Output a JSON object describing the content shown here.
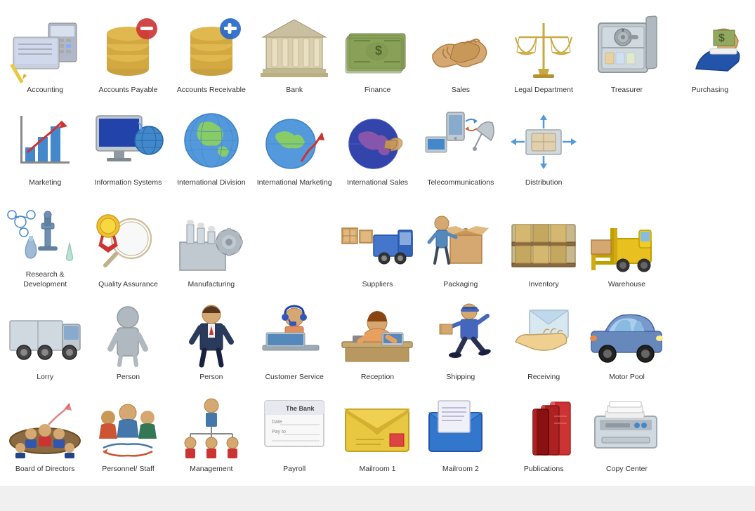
{
  "items": [
    {
      "id": "accounting",
      "label": "Accounting",
      "icon": "accounting"
    },
    {
      "id": "accounts-payable",
      "label": "Accounts Payable",
      "icon": "accounts-payable"
    },
    {
      "id": "accounts-receivable",
      "label": "Accounts Receivable",
      "icon": "accounts-receivable"
    },
    {
      "id": "bank",
      "label": "Bank",
      "icon": "bank"
    },
    {
      "id": "finance",
      "label": "Finance",
      "icon": "finance"
    },
    {
      "id": "sales",
      "label": "Sales",
      "icon": "sales"
    },
    {
      "id": "legal-department",
      "label": "Legal Department",
      "icon": "legal-department"
    },
    {
      "id": "treasurer",
      "label": "Treasurer",
      "icon": "treasurer"
    },
    {
      "id": "purchasing",
      "label": "Purchasing",
      "icon": "purchasing"
    },
    {
      "id": "marketing",
      "label": "Marketing",
      "icon": "marketing"
    },
    {
      "id": "information-systems",
      "label": "Information Systems",
      "icon": "information-systems"
    },
    {
      "id": "international-division",
      "label": "International Division",
      "icon": "international-division"
    },
    {
      "id": "international-marketing",
      "label": "International Marketing",
      "icon": "international-marketing"
    },
    {
      "id": "international-sales",
      "label": "International Sales",
      "icon": "international-sales"
    },
    {
      "id": "telecommunications",
      "label": "Telecommunications",
      "icon": "telecommunications"
    },
    {
      "id": "distribution",
      "label": "Distribution",
      "icon": "distribution"
    },
    {
      "id": "empty1",
      "label": "",
      "icon": "empty"
    },
    {
      "id": "empty2",
      "label": "",
      "icon": "empty"
    },
    {
      "id": "research",
      "label": "Research & Development",
      "icon": "research"
    },
    {
      "id": "quality-assurance",
      "label": "Quality Assurance",
      "icon": "quality-assurance"
    },
    {
      "id": "manufacturing",
      "label": "Manufacturing",
      "icon": "manufacturing"
    },
    {
      "id": "empty3",
      "label": "",
      "icon": "empty"
    },
    {
      "id": "suppliers",
      "label": "Suppliers",
      "icon": "suppliers"
    },
    {
      "id": "packaging",
      "label": "Packaging",
      "icon": "packaging"
    },
    {
      "id": "inventory",
      "label": "Inventory",
      "icon": "inventory"
    },
    {
      "id": "warehouse",
      "label": "Warehouse",
      "icon": "warehouse"
    },
    {
      "id": "empty4",
      "label": "",
      "icon": "empty"
    },
    {
      "id": "lorry",
      "label": "Lorry",
      "icon": "lorry"
    },
    {
      "id": "person1",
      "label": "Person",
      "icon": "person1"
    },
    {
      "id": "person2",
      "label": "Person",
      "icon": "person2"
    },
    {
      "id": "customer-service",
      "label": "Customer Service",
      "icon": "customer-service"
    },
    {
      "id": "reception",
      "label": "Reception",
      "icon": "reception"
    },
    {
      "id": "shipping",
      "label": "Shipping",
      "icon": "shipping"
    },
    {
      "id": "receiving",
      "label": "Receiving",
      "icon": "receiving"
    },
    {
      "id": "motor-pool",
      "label": "Motor Pool",
      "icon": "motor-pool"
    },
    {
      "id": "empty5",
      "label": "",
      "icon": "empty"
    },
    {
      "id": "board-of-directors",
      "label": "Board of Directors",
      "icon": "board-of-directors"
    },
    {
      "id": "personnel-staff",
      "label": "Personnel/ Staff",
      "icon": "personnel-staff"
    },
    {
      "id": "management",
      "label": "Management",
      "icon": "management"
    },
    {
      "id": "payroll",
      "label": "Payroll",
      "icon": "payroll"
    },
    {
      "id": "mailroom1",
      "label": "Mailroom 1",
      "icon": "mailroom1"
    },
    {
      "id": "mailroom2",
      "label": "Mailroom 2",
      "icon": "mailroom2"
    },
    {
      "id": "publications",
      "label": "Publications",
      "icon": "publications"
    },
    {
      "id": "copy-center",
      "label": "Copy Center",
      "icon": "copy-center"
    },
    {
      "id": "empty6",
      "label": "",
      "icon": "empty"
    }
  ]
}
